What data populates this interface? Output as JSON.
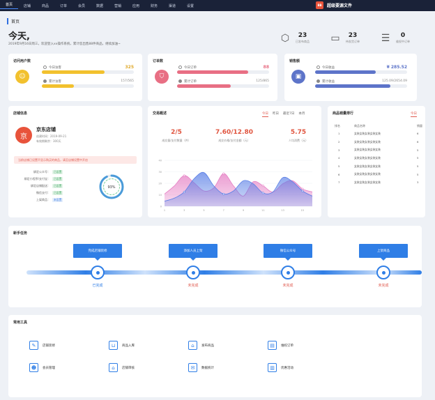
{
  "nav": {
    "items": [
      "首页",
      "店铺",
      "商品",
      "订单",
      "会员",
      "数据",
      "营销",
      "应用",
      "财务",
      "渠道",
      "设置"
    ],
    "brand_logo": "BB",
    "brand_name": "超级要源文件"
  },
  "breadcrumb": "首页",
  "greeting": {
    "title": "今天,",
    "subtitle": "2019年9月16日周三，欢迎登入xx操作系统，累计您出售88件商品，继续加油~"
  },
  "stats": [
    {
      "icon": "box-icon",
      "value": "23",
      "label": "已发布商品"
    },
    {
      "icon": "truck-icon",
      "value": "23",
      "label": "待发货订单"
    },
    {
      "icon": "receipt-icon",
      "value": "0",
      "label": "维权中订单"
    }
  ],
  "kpi": [
    {
      "title": "访问用户数",
      "color": "#f2c12e",
      "rows": [
        {
          "label": "今日访客",
          "value": "325",
          "fill": 0.68
        },
        {
          "label": "累计访客",
          "value": "157/565",
          "fill": 0.35
        }
      ]
    },
    {
      "title": "订单数",
      "color": "#e86f84",
      "rows": [
        {
          "label": "今日订单",
          "value": "88",
          "fill": 0.77
        },
        {
          "label": "累计订单",
          "value": "125/865",
          "fill": 0.58
        }
      ]
    },
    {
      "title": "销售额",
      "color": "#5d74c9",
      "rows": [
        {
          "label": "今日收益",
          "value": "¥ 285.52",
          "fill": 0.66
        },
        {
          "label": "累计收益",
          "value": "125.09/2654.09",
          "fill": 0.82
        }
      ]
    }
  ],
  "shop": {
    "title": "店铺信息",
    "logo": "京",
    "name": "京东店铺",
    "created": "创建时间：2019-09-21",
    "valid": "有效期剩余：300天",
    "warning": "当前店铺已设置不显示购买的商品，请至店铺设置中开启",
    "checks": [
      {
        "k": "绑定公众号：",
        "v": "已设置",
        "ok": true
      },
      {
        "k": "绑定小程序/支付宝：",
        "v": "已设置",
        "ok": true
      },
      {
        "k": "绑定店铺配送：",
        "v": "已设置",
        "ok": true
      },
      {
        "k": "微信支付：",
        "v": "已设置",
        "ok": true
      },
      {
        "k": "上架商品：",
        "v": "未设置",
        "ok": false
      }
    ],
    "progress_label": "93%",
    "progress": 0.93
  },
  "overview": {
    "title": "交易概述",
    "tabs": [
      "今日",
      "昨日",
      "最近7日",
      "本月"
    ],
    "metrics": [
      {
        "value": "2/5",
        "label": "成交量/支付数量（件）"
      },
      {
        "value": "7.60/12.80",
        "label": "成交价格/支付金额（元）"
      },
      {
        "value": "5.75",
        "label": "人均消费（元）"
      }
    ]
  },
  "chart_data": {
    "type": "area",
    "x": [
      1,
      2,
      3,
      4,
      5,
      6,
      7,
      8,
      9,
      10,
      11,
      12,
      13,
      14,
      15,
      16
    ],
    "y_ticks": [
      "40",
      "30",
      "20",
      "10",
      "0"
    ],
    "ylim": [
      0,
      45
    ],
    "colors": {
      "blue": "#5a7fe6",
      "pink": "#e57dc3"
    },
    "series": [
      {
        "values": [
          12,
          20,
          30,
          23,
          15,
          18,
          32,
          20,
          10,
          24,
          20,
          14,
          22,
          25,
          17,
          14
        ]
      },
      {
        "values": [
          5,
          8,
          14,
          27,
          33,
          20,
          12,
          15,
          25,
          22,
          13,
          14,
          28,
          24,
          15,
          10
        ]
      }
    ]
  },
  "ranking": {
    "title": "商品销量排行",
    "tab": "今日",
    "headers": [
      "排名",
      "商品名称",
      "销量"
    ],
    "rows": [
      {
        "rank": "1",
        "name": "女装女装女装女装女装",
        "n": "6"
      },
      {
        "rank": "2",
        "name": "女装女装女装女装女装",
        "n": "6"
      },
      {
        "rank": "3",
        "name": "女装女装女装女装女装",
        "n": "5"
      },
      {
        "rank": "4",
        "name": "女装女装女装女装女装",
        "n": "5"
      },
      {
        "rank": "5",
        "name": "女装女装女装女装女装",
        "n": "5"
      },
      {
        "rank": "6",
        "name": "女装女装女装女装女装",
        "n": "5"
      },
      {
        "rank": "7",
        "name": "女装女装女装女装女装",
        "n": "3"
      }
    ]
  },
  "tasks": {
    "title": "新手任务",
    "steps": [
      {
        "label": "完成店铺装修",
        "status": "已完成",
        "done": true
      },
      {
        "label": "添加人员上架",
        "status": "未完成",
        "done": false
      },
      {
        "label": "微信公众号",
        "status": "未完成",
        "done": false
      },
      {
        "label": "上架商品",
        "status": "未完成",
        "done": false
      }
    ]
  },
  "tools": {
    "title": "常用工具",
    "items": [
      {
        "icon": "brush-icon",
        "label": "店铺装修"
      },
      {
        "icon": "bag-icon",
        "label": "商品入库"
      },
      {
        "icon": "home-icon",
        "label": "发布商品"
      },
      {
        "icon": "doc-icon",
        "label": "维权订单"
      },
      {
        "icon": "users-icon",
        "label": "会员管理"
      },
      {
        "icon": "house-icon",
        "label": "店铺审核"
      },
      {
        "icon": "mail-icon",
        "label": "数据统计"
      },
      {
        "icon": "file-icon",
        "label": "优惠活动"
      }
    ]
  }
}
